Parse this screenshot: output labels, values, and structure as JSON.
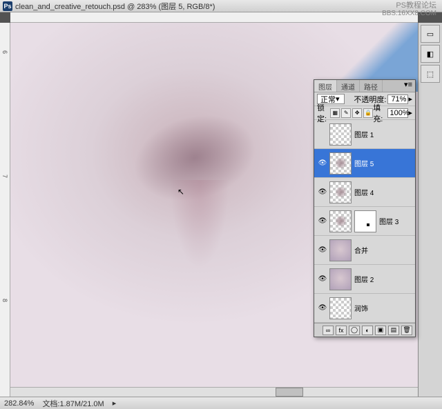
{
  "titlebar": {
    "filename": "clean_and_creative_retouch.psd",
    "zoom": "283%",
    "layer_info": "(图层 5, RGB/8*)"
  },
  "watermark": {
    "line1": "PS教程论坛",
    "line2": "BBS.16XX8.COM"
  },
  "ruler": {
    "tick_6": "6",
    "tick_7": "7",
    "tick_8": "8"
  },
  "panel": {
    "tabs": {
      "t0": "图层",
      "t1": "通道",
      "t2": "路径"
    },
    "blend_mode": "正常",
    "opacity_label": "不透明度:",
    "opacity_value": "71%",
    "lock_label": "锁定:",
    "fill_label": "填充:",
    "fill_value": "100%"
  },
  "layers": [
    {
      "name": "图层 1"
    },
    {
      "name": "图层 5"
    },
    {
      "name": "图层 4"
    },
    {
      "name": "图层 3"
    },
    {
      "name": "合并"
    },
    {
      "name": "图层 2"
    },
    {
      "name": "润饰"
    }
  ],
  "status": {
    "zoom": "282.84%",
    "doc": "文档:1.87M/21.0M"
  }
}
